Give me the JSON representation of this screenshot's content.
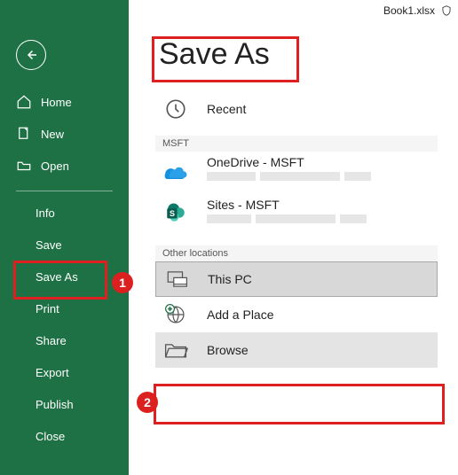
{
  "titlebar": {
    "filename": "Book1.xlsx"
  },
  "page": {
    "title": "Save As"
  },
  "sidebar": {
    "nav": [
      {
        "label": "Home"
      },
      {
        "label": "New"
      },
      {
        "label": "Open"
      }
    ],
    "sub": [
      {
        "label": "Info"
      },
      {
        "label": "Save"
      },
      {
        "label": "Save As"
      },
      {
        "label": "Print"
      },
      {
        "label": "Share"
      },
      {
        "label": "Export"
      },
      {
        "label": "Publish"
      },
      {
        "label": "Close"
      }
    ]
  },
  "locations": {
    "recent": "Recent",
    "section_msft": "MSFT",
    "onedrive": "OneDrive - MSFT",
    "sites": "Sites - MSFT",
    "section_other": "Other locations",
    "thispc": "This PC",
    "addplace": "Add a Place",
    "browse": "Browse"
  },
  "annotations": {
    "badge1": "1",
    "badge2": "2"
  }
}
